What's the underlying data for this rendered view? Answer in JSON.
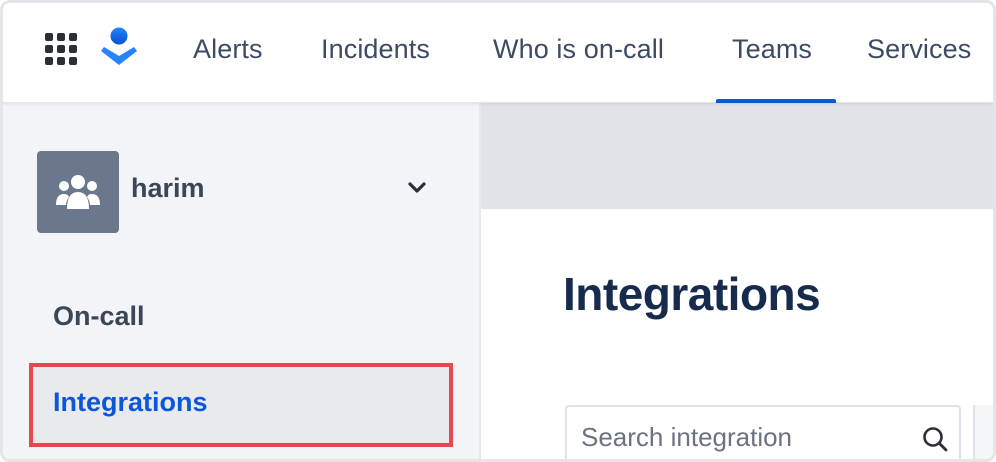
{
  "topnav": {
    "items": [
      {
        "label": "Alerts"
      },
      {
        "label": "Incidents"
      },
      {
        "label": "Who is on-call"
      },
      {
        "label": "Teams",
        "active": true
      },
      {
        "label": "Services"
      }
    ]
  },
  "sidebar": {
    "team_name": "harim",
    "items": [
      {
        "label": "On-call"
      },
      {
        "label": "Integrations",
        "selected": true
      }
    ]
  },
  "main": {
    "title": "Integrations",
    "search": {
      "placeholder": "Search integration",
      "value": ""
    }
  },
  "colors": {
    "accent": "#0c57d9",
    "highlight_border": "#e5484d",
    "sidebar_bg": "#f3f4f7",
    "title": "#172b4d"
  },
  "icons": {
    "apps": "apps-grid-icon",
    "logo": "opsgenie-logo-icon",
    "team": "team-people-icon",
    "chevron": "chevron-down-icon",
    "search": "search-icon"
  }
}
